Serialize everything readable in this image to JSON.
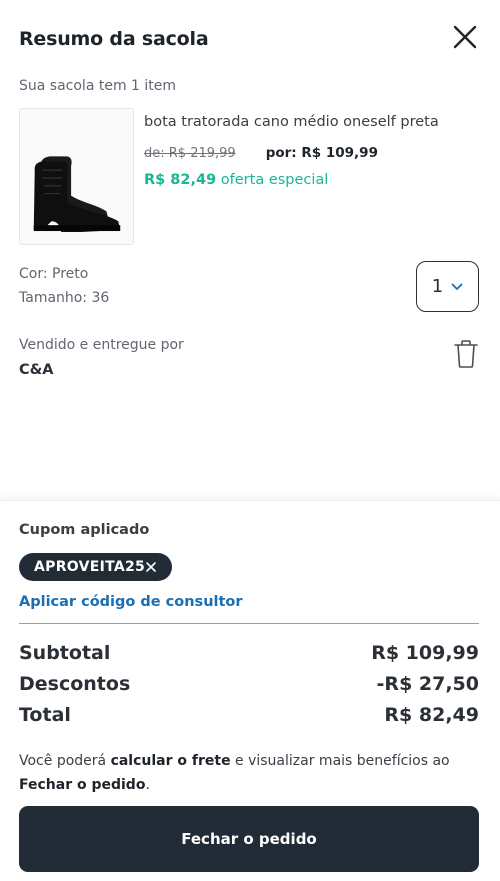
{
  "header": {
    "title": "Resumo da sacola"
  },
  "bag": {
    "count_text": "Sua sacola tem 1 item"
  },
  "product": {
    "name": "bota tratorada cano médio oneself preta",
    "old_price": "de: R$ 219,99",
    "for_price": "por: R$ 109,99",
    "special_price": "R$ 82,49",
    "special_label": "oferta especial",
    "color": "Cor: Preto",
    "size": "Tamanho: 36",
    "quantity": "1",
    "seller_label": "Vendido e entregue por",
    "seller_name": "C&A"
  },
  "coupon": {
    "label": "Cupom aplicado",
    "code": "APROVEITA25",
    "consultant_link": "Aplicar código de consultor"
  },
  "totals": {
    "subtotal_label": "Subtotal",
    "subtotal_value": "R$ 109,99",
    "discount_label": "Descontos",
    "discount_value": "-R$ 27,50",
    "total_label": "Total",
    "total_value": "R$ 82,49"
  },
  "note": {
    "part1": "Você poderá ",
    "bold1": "calcular o frete",
    "part2": " e visualizar mais benefícios ao ",
    "bold2": "Fechar o pedido",
    "part3": "."
  },
  "cta": {
    "label": "Fechar o pedido"
  },
  "colors": {
    "dark": "#222c36",
    "special": "#17b892",
    "link": "#1a6fb5"
  },
  "icons": {
    "close": "close-icon",
    "quantity_chevron": "chevron-down-icon",
    "delete": "trash-icon",
    "remove_coupon": "close-icon"
  }
}
